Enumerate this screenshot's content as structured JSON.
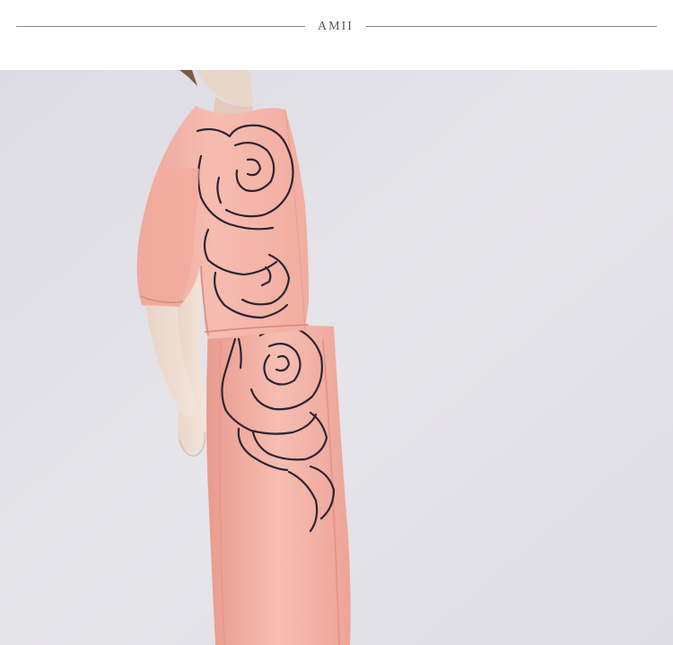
{
  "header": {
    "brand": "AMII"
  },
  "photo": {
    "subject": "model-in-pink-rose-print-top-and-skirt"
  },
  "colors": {
    "background": "#e4e3e9",
    "garment": "#f5b5aa",
    "garment_shadow": "#e69c91",
    "outline": "#2b2534",
    "skin": "#f0dfd4",
    "hair": "#7a5a45"
  }
}
